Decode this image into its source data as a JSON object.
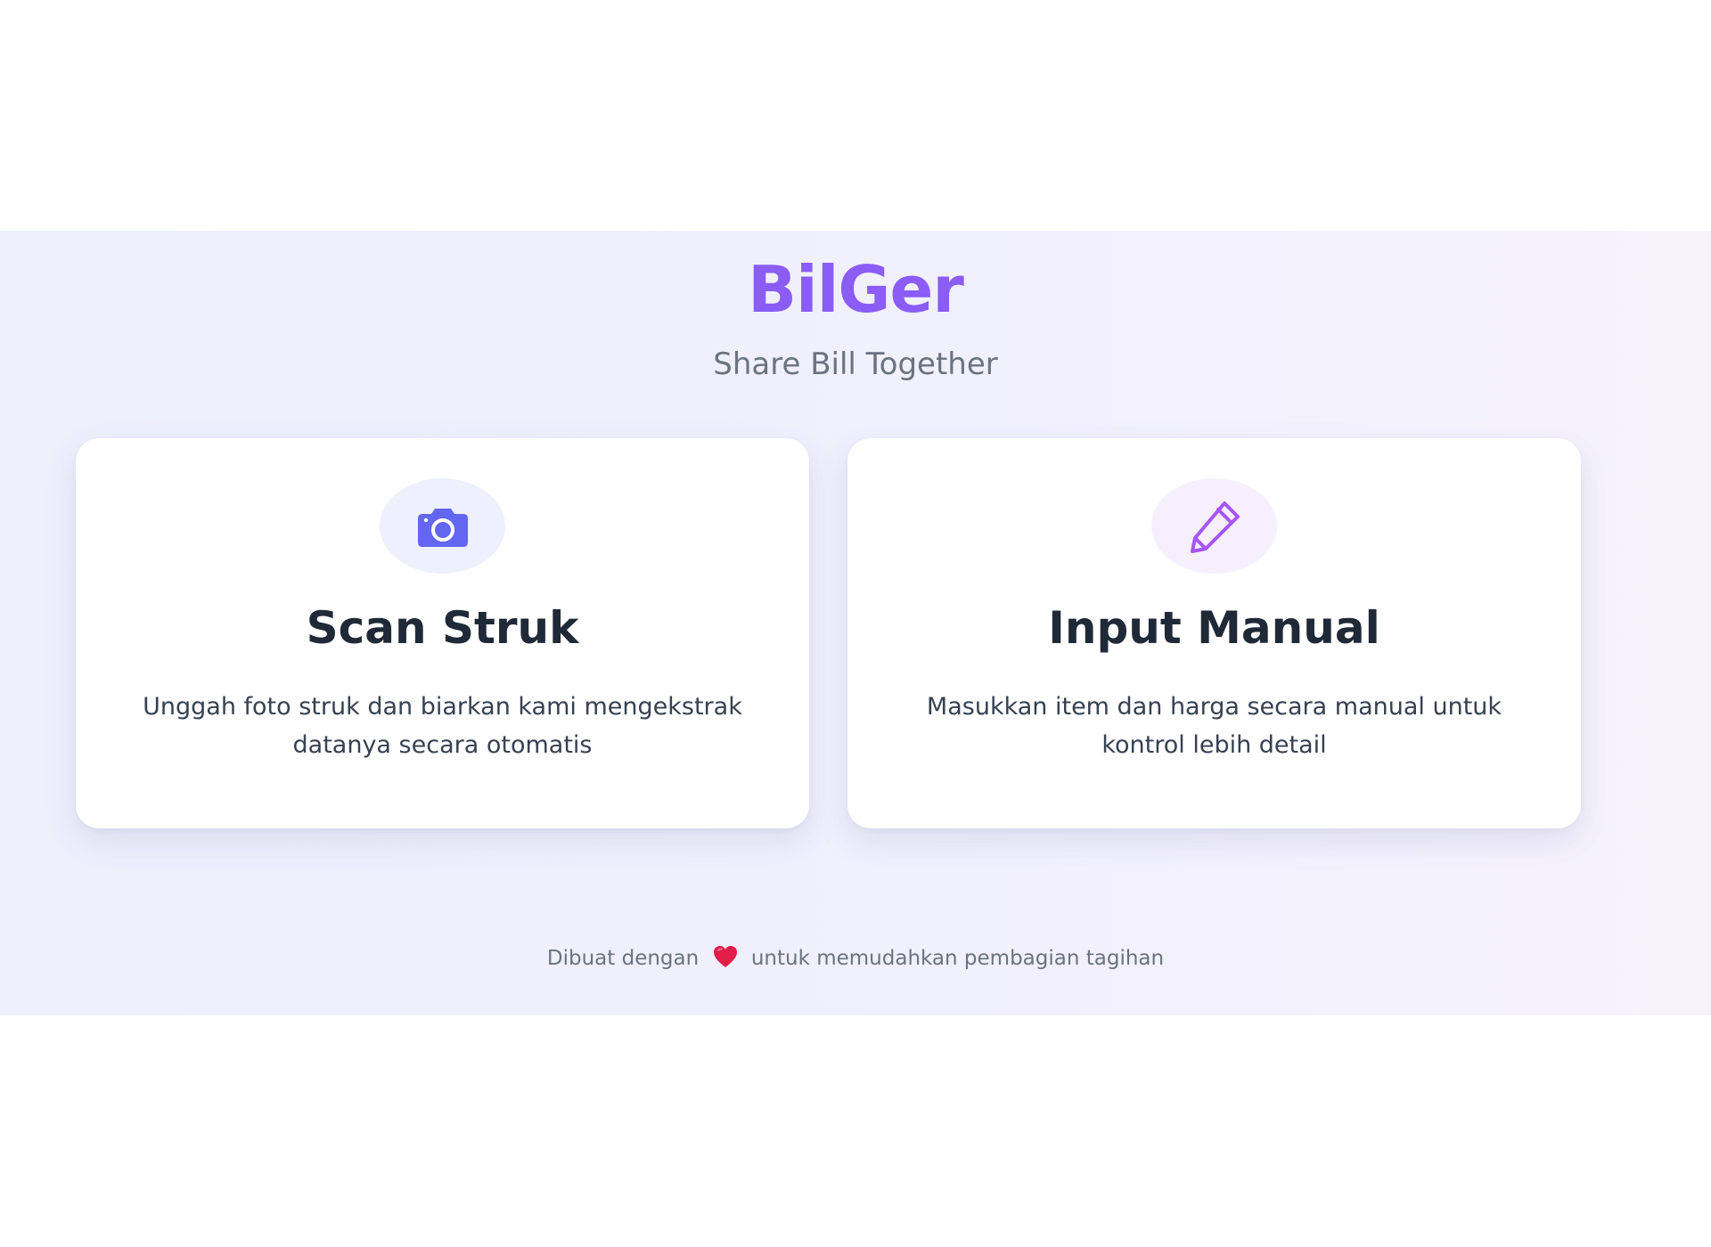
{
  "header": {
    "brand": "BilGer",
    "tagline": "Share Bill Together"
  },
  "options": [
    {
      "icon": "camera-icon",
      "title": "Scan Struk",
      "description": "Unggah foto struk dan biarkan kami mengekstrak datanya secara otomatis"
    },
    {
      "icon": "pencil-icon",
      "title": "Input Manual",
      "description": "Masukkan item dan harga secara manual untuk kontrol lebih detail"
    }
  ],
  "footer": {
    "before": "Dibuat dengan",
    "icon": "heart-icon",
    "after": "untuk memudahkan pembagian tagihan"
  },
  "colors": {
    "brand": "#8b5cf6",
    "camera": "#6366f1",
    "pencil": "#a855f7",
    "heart": "#e11d48",
    "title": "#1f2937",
    "muted": "#6b7280",
    "background": "#eef0fc"
  }
}
